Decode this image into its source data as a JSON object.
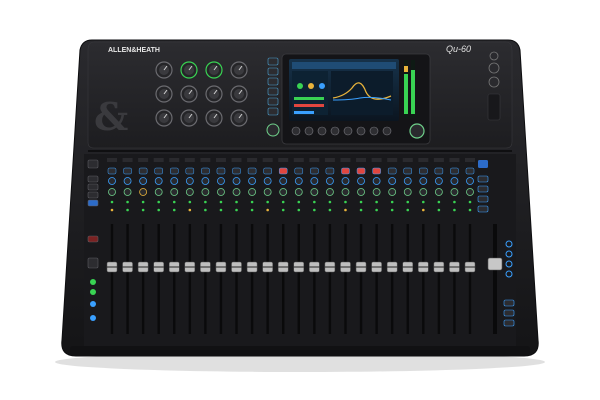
{
  "product": {
    "brand": "ALLEN&HEATH",
    "model": "Qu-60",
    "panel_logo": "&"
  },
  "mixer": {
    "channel_strips": 24,
    "preamp_knob_rows": 3,
    "preamp_knob_columns": 4,
    "screen_buttons": 8
  },
  "colors": {
    "body": "#1c1c1f",
    "top_panel": "#232327",
    "screen_bg": "#101820",
    "accent_green": "#39d353",
    "accent_blue": "#3aa0ff",
    "mute_red": "#e0463f",
    "fader_cap": "#bfbfbf"
  },
  "icons": [
    "gain-knob-icon",
    "fader-icon",
    "mute-button-icon",
    "touchscreen-icon",
    "rotary-encoder-icon"
  ]
}
